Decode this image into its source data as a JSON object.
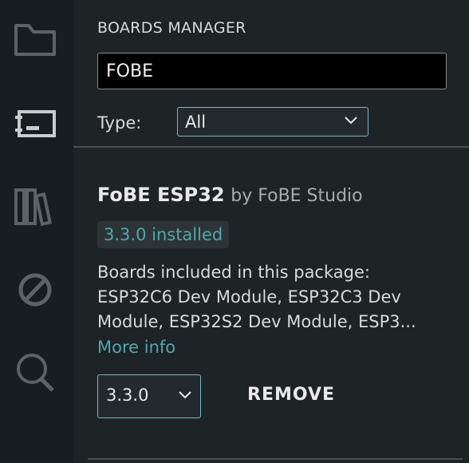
{
  "sidebar": {
    "title": "BOARDS MANAGER",
    "search": {
      "value": "FOBE",
      "placeholder": ""
    },
    "filter": {
      "label": "Type:",
      "selected": "All"
    }
  },
  "package": {
    "name": "FoBE ESP32",
    "author": "by FoBE Studio",
    "installed_badge": "3.3.0 installed",
    "description_lines": [
      "Boards included in this package:",
      "ESP32C6 Dev Module, ESP32C3 Dev",
      "Module, ESP32S2 Dev Module, ESP3..."
    ],
    "more_info": "More info",
    "version_selected": "3.3.0",
    "remove_label": "REMOVE"
  },
  "activity_bar": {
    "icons": [
      "folder-icon",
      "board-icon",
      "library-icon",
      "debug-icon",
      "search-icon"
    ]
  },
  "colors": {
    "accent": "#53a6ab",
    "panel_bg": "#1e2326",
    "activity_bg": "#171e21"
  }
}
